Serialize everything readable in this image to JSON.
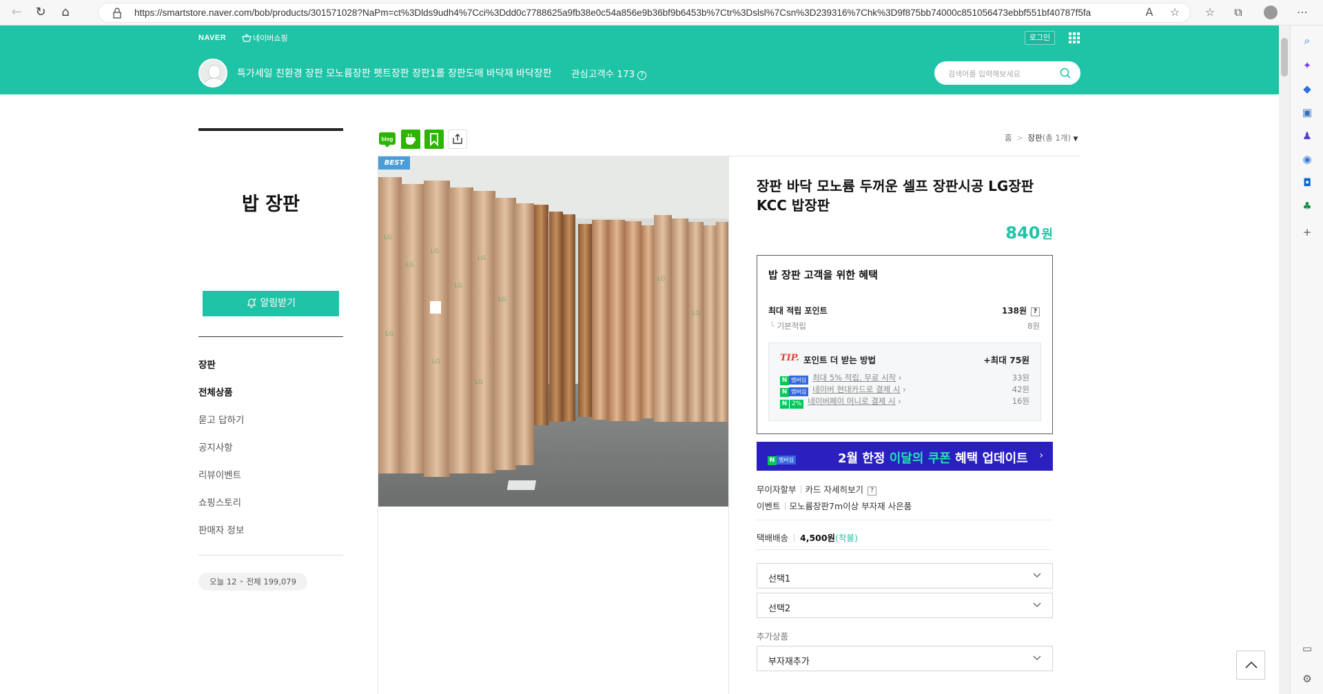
{
  "browser": {
    "url": "https://smartstore.naver.com/bob/products/301571028?NaPm=ct%3Dlds9udh4%7Cci%3Ddd0c7788625a9fb38e0c54a856e9b36bf9b6453b%7Ctr%3Dslsl%7Csn%3D239316%7Chk%3D9f875bb74000c851056473ebbf551bf40787f5fa"
  },
  "topbar": {
    "logo": "NAVER",
    "shopping_link": "네이버쇼핑",
    "login": "로그인"
  },
  "store": {
    "name": "특가세일 친환경 장판 모노륨장판 펫트장판 장판1롤 장판도매 바닥재 바닥장판",
    "favorites_label": "관심고객수 173",
    "search_placeholder": "검색어를 입력해보세요"
  },
  "sidebar": {
    "title": "밥 장판",
    "notify_button": "알림받기",
    "menu": [
      "장판",
      "전체상품",
      "묻고 답하기",
      "공지사항",
      "리뷰이벤트",
      "쇼핑스토리",
      "판매자 정보"
    ],
    "visits_today_label": "오늘 12",
    "visits_total_label": "전체 199,079"
  },
  "breadcrumb": {
    "home": "홈",
    "category": "장판",
    "count": "(총 1개)"
  },
  "product": {
    "badge": "BEST",
    "title": "장판 바닥 모노륨 두꺼운 셀프 장판시공 LG장판 KCC 밥장판",
    "price": "840",
    "currency": "원"
  },
  "benefit": {
    "title": "밥 장판 고객을 위한 혜택",
    "max_points_label": "최대 적립 포인트",
    "max_points_value": "138원",
    "base_label": "기본적립",
    "base_value": "8원",
    "tip_label": "TIP.",
    "tip_title": "포인트 더 받는 방법",
    "tip_max": "+최대 75원",
    "tip_rows": [
      {
        "badge": "멤버십",
        "text": "최대 5% 적립, 무료 시작",
        "points": "33원"
      },
      {
        "badge": "멤버십",
        "text": "네이버 현대카드로 결제 시",
        "points": "42원"
      },
      {
        "badge": "2%",
        "text": "네이버페이 머니로 결제 시",
        "points": "16원"
      }
    ]
  },
  "promo": {
    "badge": "멤버십",
    "part1": "2월 한정 ",
    "part2": "이달의 쿠폰",
    "part3": " 혜택 업데이트"
  },
  "meta": {
    "installment": "무이자할부",
    "card_detail": "카드 자세히보기",
    "event_label": "이벤트",
    "event_text": "모노륨장판7m이상 부자재 사은품"
  },
  "shipping": {
    "label": "택배배송",
    "fee": "4,500원",
    "type": "(착불)"
  },
  "options": {
    "select1": "선택1",
    "select2": "선택2",
    "additional_label": "추가상품",
    "additional_select": "부자재추가"
  },
  "colors": {
    "brand_green": "#1fc3a6",
    "promo_blue": "#2a1fbf",
    "naver_green": "#03c75a"
  }
}
